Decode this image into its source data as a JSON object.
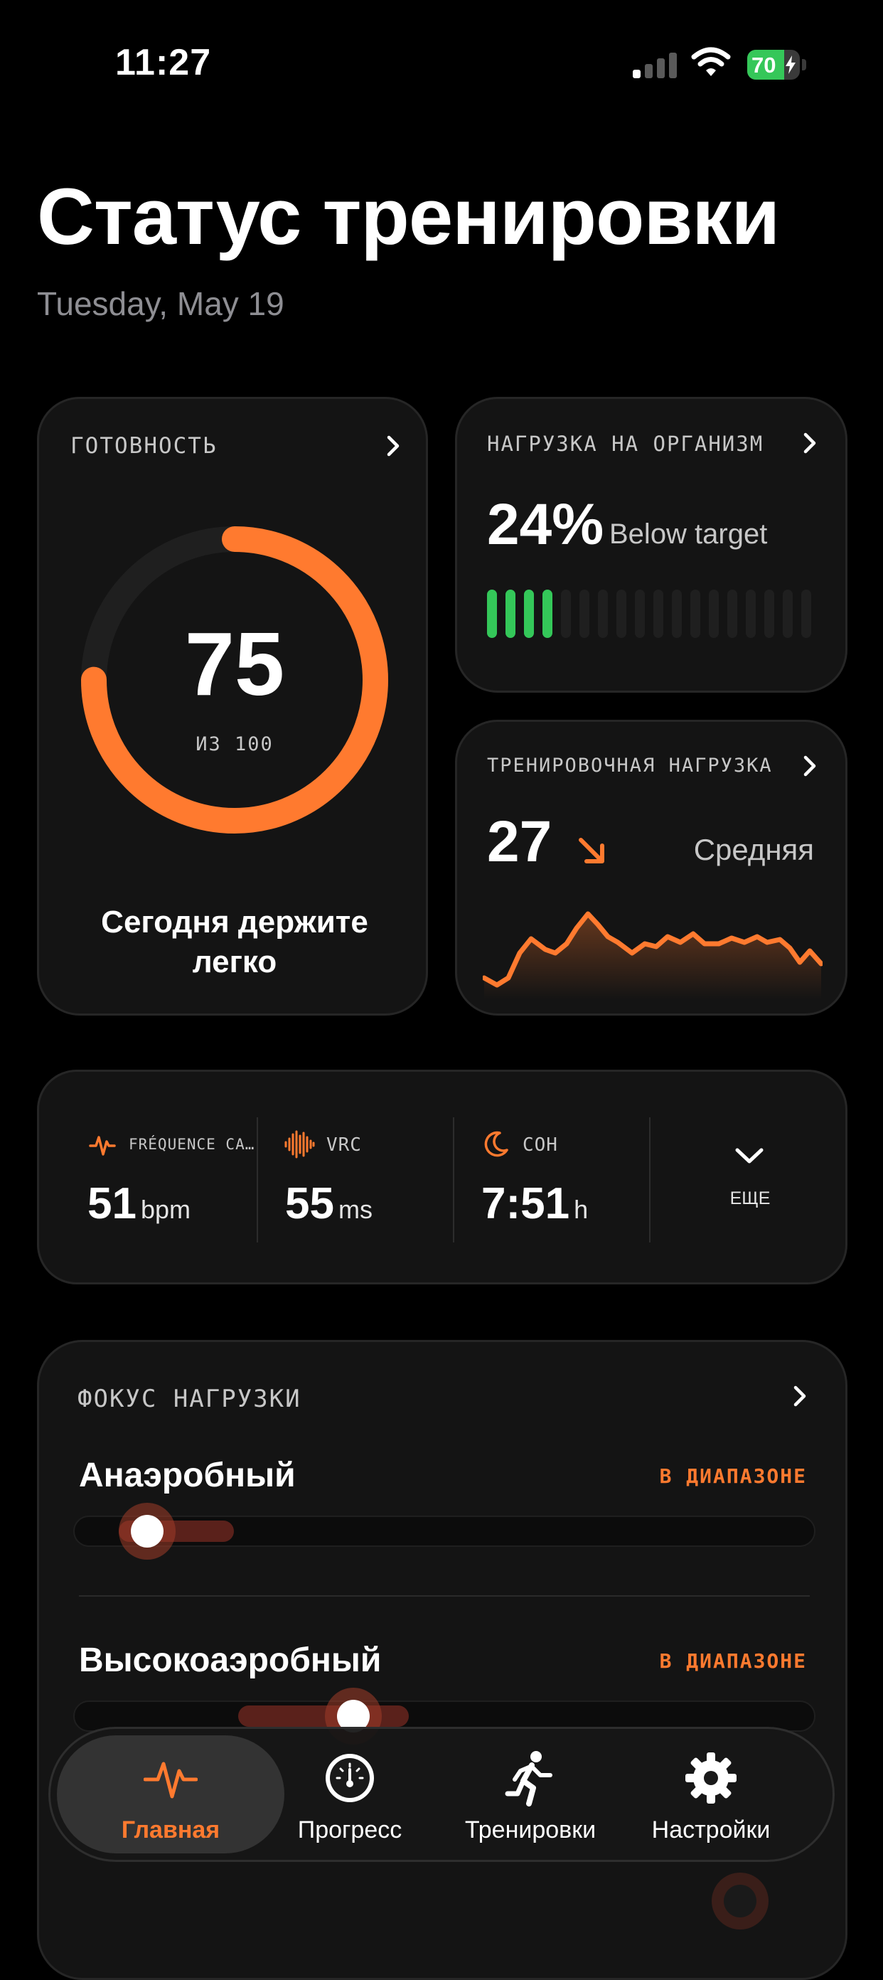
{
  "status_bar": {
    "time": "11:27",
    "battery": "70",
    "battery_level": 0.7
  },
  "header": {
    "title": "Статус тренировки",
    "date": "Tuesday, May 19"
  },
  "readiness": {
    "label": "ГОТОВНОСТЬ",
    "value": "75",
    "scale": "ИЗ 100",
    "progress": 0.75,
    "message_line1": "Сегодня держите",
    "message_line2": "легко"
  },
  "strain": {
    "label": "НАГРУЗКА НА ОРГАНИЗМ",
    "value": "24%",
    "status": "Below target",
    "level_fraction": 0.24
  },
  "training_load": {
    "label": "ТРЕНИРОВОЧНАЯ НАГРУЗКА",
    "value": "27",
    "trend_icon": "arrow-down-right-icon",
    "level": "Средняя"
  },
  "metrics": {
    "heart_rate": {
      "label": "FRÉQUENCE CA…",
      "value": "51",
      "unit": "bpm",
      "icon": "heartbeat-icon"
    },
    "hrv": {
      "label": "VRC",
      "value": "55",
      "unit": "ms",
      "icon": "waveform-icon"
    },
    "sleep": {
      "label": "СОН",
      "value": "7:51",
      "unit": "h",
      "icon": "moon-icon"
    },
    "more_label": "ЕЩЕ"
  },
  "focus": {
    "label": "ФОКУС НАГРУЗКИ",
    "items": [
      {
        "name": "Анаэробный",
        "status": "В ДИАПАЗОНЕ"
      },
      {
        "name": "Высокоаэробный",
        "status": "В ДИАПАЗОНЕ"
      }
    ]
  },
  "tabs": [
    {
      "label": "Главная",
      "icon": "heartbeat-icon",
      "active": true
    },
    {
      "label": "Прогресс",
      "icon": "gauge-icon"
    },
    {
      "label": "Тренировки",
      "icon": "running-icon"
    },
    {
      "label": "Настройки",
      "icon": "gear-icon"
    }
  ],
  "colors": {
    "accent": "#ff7a2f",
    "green": "#34c759",
    "card": "#141414",
    "background": "#000000"
  }
}
